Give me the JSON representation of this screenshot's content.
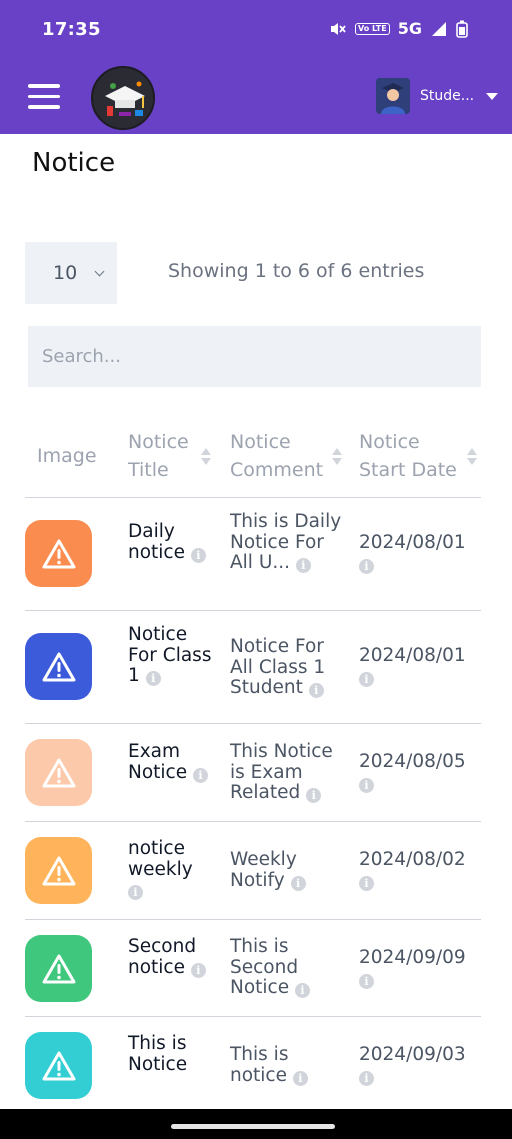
{
  "status_bar": {
    "time": "17:35",
    "network": "5G",
    "volte": "Vo LTE"
  },
  "app_bar": {
    "user_name": "Stude..."
  },
  "page": {
    "title": "Notice"
  },
  "table_controls": {
    "entries_value": "10",
    "showing_text": "Showing 1 to 6 of 6 entries",
    "search_placeholder": "Search..."
  },
  "table": {
    "headers": {
      "image": "Image",
      "title": "Notice Title",
      "comment": "Notice Comment",
      "start_date": "Notice Start Date"
    },
    "rows": [
      {
        "color": "#fb8c50",
        "title": "Daily notice",
        "comment": "This is Daily Notice For All U...",
        "date": "2024/08/01"
      },
      {
        "color": "#3b5bdb",
        "title": "Notice For Class 1",
        "comment": "Notice For All Class 1 Student",
        "date": "2024/08/01"
      },
      {
        "color": "#fcc9ab",
        "title": "Exam Notice",
        "comment": "This Notice is Exam Related",
        "date": "2024/08/05"
      },
      {
        "color": "#ffb45c",
        "title": "notice weekly",
        "comment": "Weekly Notify",
        "date": "2024/08/02"
      },
      {
        "color": "#3fc77d",
        "title": "Second notice",
        "comment": "This is Second Notice",
        "date": "2024/09/09"
      },
      {
        "color": "#33ced3",
        "title": "This is Notice",
        "comment": "This is notice",
        "date": "2024/09/03"
      }
    ]
  },
  "icons": {
    "menu": "hamburger-menu-icon",
    "row_icon": "warning-triangle-icon",
    "info": "info-icon",
    "sort": "sort-icon",
    "dropdown": "chevron-down-icon"
  },
  "colors": {
    "primary": "#6941c6",
    "input_bg": "#eef2f7"
  }
}
